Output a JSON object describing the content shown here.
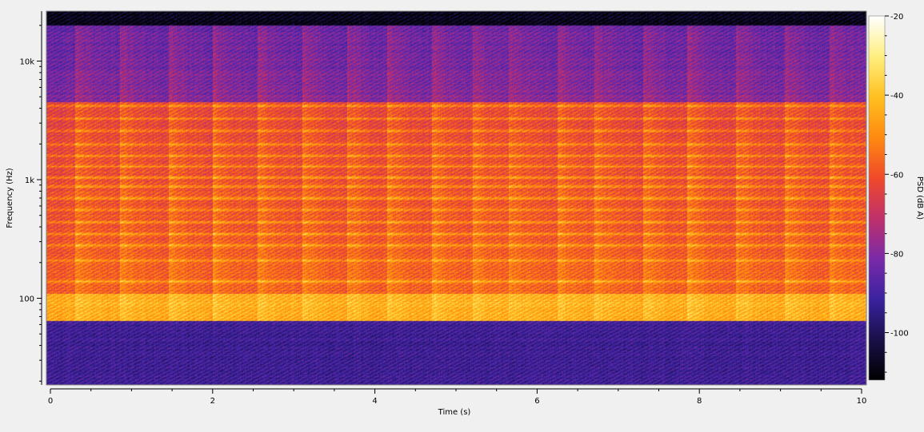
{
  "chart_data": {
    "type": "heatmap",
    "subtype": "spectrogram",
    "xlabel": "Time (s)",
    "ylabel": "Frequency (Hz)",
    "colorbar_label": "PSD (dB A)",
    "xlim": [
      0,
      10
    ],
    "ylim": [
      35,
      25000
    ],
    "yscale": "log",
    "x_ticks": [
      0,
      2,
      4,
      6,
      8,
      10
    ],
    "x_tick_labels": [
      "0",
      "2",
      "4",
      "6",
      "8",
      "10"
    ],
    "x_minor_step": 0.5,
    "y_ticks": [
      100,
      1000,
      10000
    ],
    "y_tick_labels": [
      "100",
      "1k",
      "10k"
    ],
    "colorbar_range": [
      -112,
      -20
    ],
    "colorbar_ticks": [
      -20,
      -40,
      -60,
      -80,
      -100
    ],
    "colorbar_tick_labels": [
      "-20",
      "-40",
      "-60",
      "-80",
      "-100"
    ],
    "colormap": "hot-plasma",
    "colormap_stops": [
      "#000000",
      "#1a1048",
      "#3a22a0",
      "#7a2aa8",
      "#c0306a",
      "#f04a2a",
      "#ff8a10",
      "#ffc020",
      "#ffef80",
      "#ffffff"
    ],
    "background_level": -112,
    "note_onsets_s": [
      0.3,
      0.85,
      1.45,
      2.0,
      2.55,
      3.1,
      3.65,
      4.15,
      4.7,
      5.2,
      5.65,
      6.25,
      6.7,
      7.3,
      7.85,
      8.45,
      9.05,
      9.6
    ],
    "harmonic_bands_hz": [
      70,
      140,
      210,
      280,
      350,
      440,
      560,
      700,
      880,
      1050,
      1300,
      1600,
      2000,
      2600,
      3300,
      4200
    ],
    "energy_profile": {
      "low_band_hz": [
        35,
        65
      ],
      "low_band_level": -95,
      "bass_band_hz": [
        65,
        110
      ],
      "bass_band_level": -48,
      "mid_band_hz": [
        110,
        4500
      ],
      "mid_band_level": -62,
      "high_band_hz": [
        4500,
        20000
      ],
      "high_band_level": -85,
      "cutoff_hz": 20000
    }
  }
}
